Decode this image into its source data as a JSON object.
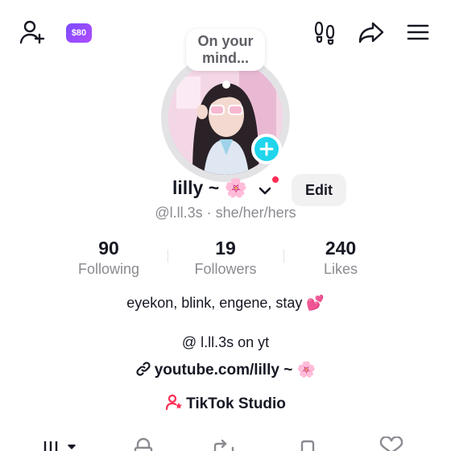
{
  "top_bar": {
    "add_friend_icon": "person-plus-icon",
    "coin_badge": "$80",
    "footprints_icon": "footprints-icon",
    "share_icon": "share-arrow-icon",
    "menu_icon": "hamburger-menu-icon"
  },
  "note": {
    "line1": "On your",
    "line2": "mind..."
  },
  "profile": {
    "name": "lilly ~ 🌸",
    "handle": "@l.ll.3s · she/her/hers",
    "edit_label": "Edit",
    "accent_color": "#20d5ec",
    "notification_color": "#fe2c55"
  },
  "stats": [
    {
      "value": "90",
      "label": "Following"
    },
    {
      "value": "19",
      "label": "Followers"
    },
    {
      "value": "240",
      "label": "Likes"
    }
  ],
  "bio": {
    "line1": "eyekon, blink, engene, stay 💕",
    "line2": "@ l.ll.3s on yt"
  },
  "link": {
    "text": "youtube.com/lilly ~ 🌸",
    "icon": "link-icon"
  },
  "studio": {
    "text": "TikTok Studio",
    "icon": "creator-studio-icon"
  },
  "tabs": [
    "videos-grid-icon",
    "private-lock-icon",
    "repost-icon",
    "bookmark-icon",
    "liked-heart-icon"
  ]
}
